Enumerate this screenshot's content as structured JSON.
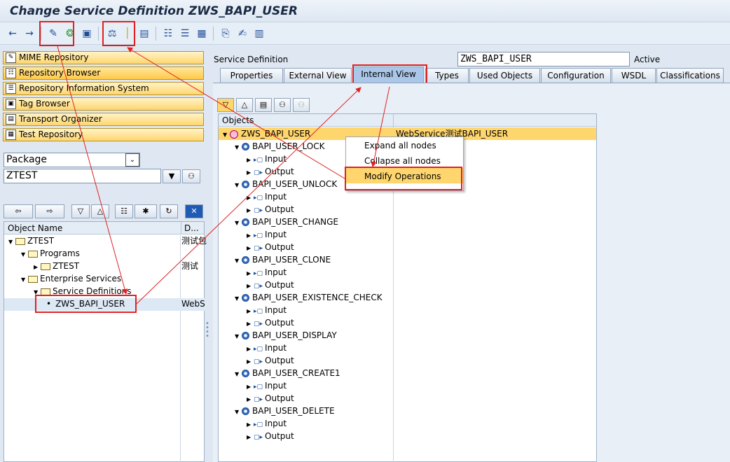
{
  "title": "Change Service Definition ZWS_BAPI_USER",
  "toolbar_icons": [
    "back-icon",
    "forward-icon",
    "display-change-icon",
    "activate-icon",
    "other-object-icon",
    "check-icon",
    "where-used-icon",
    "display-object-list-icon",
    "navigation-window-icon",
    "hierarchy-icon",
    "enhance-icon",
    "info-icon",
    "copy-icon",
    "edit-icon",
    "document-icon"
  ],
  "left_nav": [
    "MIME Repository",
    "Repository Browser",
    "Repository Information System",
    "Tag Browser",
    "Transport Organizer",
    "Test Repository"
  ],
  "object_type": "Package",
  "object_value": "ZTEST",
  "tree_header": {
    "name": "Object Name",
    "desc": "D..."
  },
  "tree": [
    {
      "label": "ZTEST",
      "desc": "测试包"
    },
    {
      "label": "Programs",
      "desc": ""
    },
    {
      "label": "ZTEST",
      "desc": "测试"
    },
    {
      "label": "Enterprise Services",
      "desc": ""
    },
    {
      "label": "Service Definitions",
      "desc": ""
    },
    {
      "label": "ZWS_BAPI_USER",
      "desc": "WebS"
    }
  ],
  "service_definition_label": "Service Definition",
  "service_definition_value": "ZWS_BAPI_USER",
  "status": "Active",
  "tabs": [
    "Properties",
    "External View",
    "Internal View",
    "Types",
    "Used Objects",
    "Configuration",
    "WSDL",
    "Classifications"
  ],
  "objects_header": "Objects",
  "root": {
    "label": "ZWS_BAPI_USER",
    "desc": "WebService测试BAPI_USER"
  },
  "operations": [
    "BAPI_USER_LOCK",
    "BAPI_USER_UNLOCK",
    "BAPI_USER_CHANGE",
    "BAPI_USER_CLONE",
    "BAPI_USER_EXISTENCE_CHECK",
    "BAPI_USER_DISPLAY",
    "BAPI_USER_CREATE1",
    "BAPI_USER_DELETE"
  ],
  "io": {
    "input": "Input",
    "output": "Output"
  },
  "context_menu": [
    "Expand all nodes",
    "Collapse all nodes",
    "Modify Operations"
  ]
}
